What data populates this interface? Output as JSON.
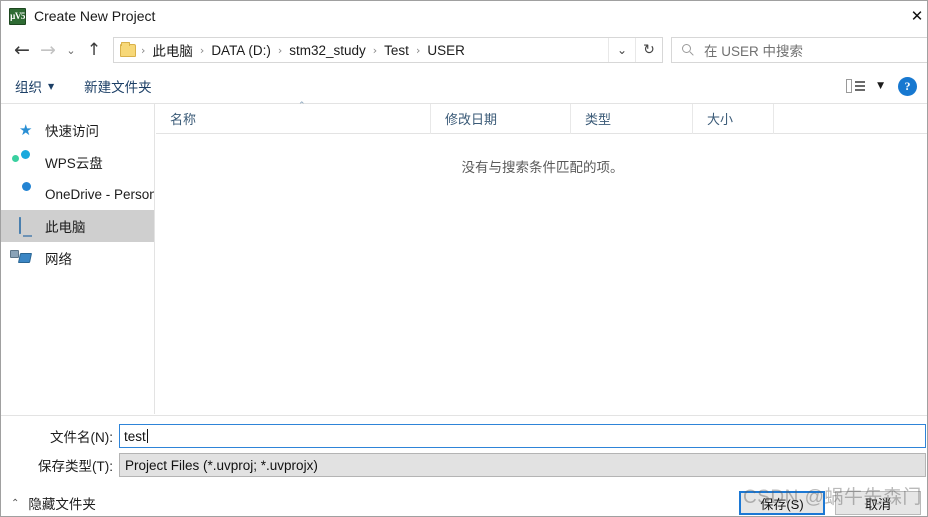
{
  "window": {
    "title": "Create New Project",
    "app_icon": "uvision-icon",
    "app_icon_glyph": "µV5",
    "close_label": "✕"
  },
  "nav": {
    "back": "←",
    "forward": "→",
    "history": "⌄",
    "up": "↑",
    "address_chevron": "⌄",
    "refresh": "↻"
  },
  "breadcrumb": {
    "folder_icon": "folder-icon",
    "separator": "›",
    "items": [
      "此电脑",
      "DATA (D:)",
      "stm32_study",
      "Test",
      "USER"
    ]
  },
  "search": {
    "placeholder": "在 USER 中搜索",
    "icon": "search-icon"
  },
  "toolbar": {
    "organize_label": "组织",
    "organize_caret": "▼",
    "new_folder_label": "新建文件夹",
    "view_caret": "▼",
    "help_label": "?"
  },
  "sidebar": {
    "items": [
      {
        "label": "快速访问",
        "icon": "star-icon",
        "selected": false
      },
      {
        "label": "WPS云盘",
        "icon": "wps-cloud-icon",
        "selected": false
      },
      {
        "label": "OneDrive - Persona",
        "icon": "onedrive-cloud-icon",
        "selected": false
      },
      {
        "label": "此电脑",
        "icon": "this-pc-icon",
        "selected": true
      },
      {
        "label": "网络",
        "icon": "network-icon",
        "selected": false
      }
    ]
  },
  "filelist": {
    "columns": [
      "名称",
      "修改日期",
      "类型",
      "大小"
    ],
    "sort_caret": "⌃",
    "empty_message": "没有与搜索条件匹配的项。",
    "rows": []
  },
  "fields": {
    "filename_label": "文件名(N):",
    "filename_value": "test",
    "filetype_label": "保存类型(T):",
    "filetype_value": "Project Files (*.uvproj; *.uvprojx)"
  },
  "footer": {
    "hide_folders_label": "隐藏文件夹",
    "hide_folders_caret": "⌃",
    "save_label": "保存(S)",
    "cancel_label": "取消"
  },
  "watermark": {
    "text": "CSDN @蜗牛先森门"
  },
  "colors": {
    "accent": "#1c78d4",
    "link_blue": "#1c3f66",
    "selection": "#cfcfcf",
    "icon_green": "#2e6b33"
  }
}
